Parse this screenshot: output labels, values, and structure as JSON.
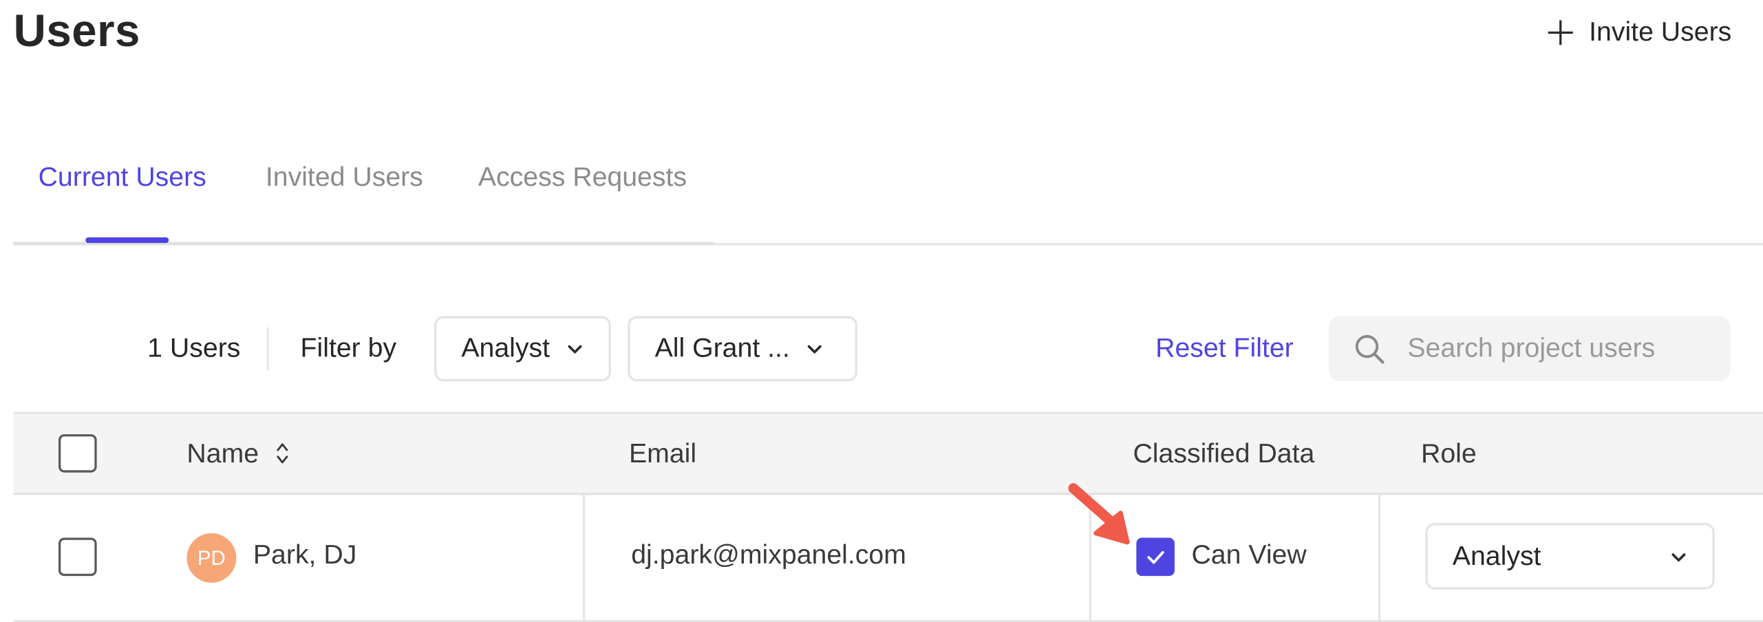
{
  "header": {
    "title": "Users",
    "invite_label": "Invite Users"
  },
  "tabs": [
    {
      "label": "Current Users",
      "active": true
    },
    {
      "label": "Invited Users",
      "active": false
    },
    {
      "label": "Access Requests",
      "active": false
    }
  ],
  "filters": {
    "user_count": "1 Users",
    "filter_by_label": "Filter by",
    "role_filter": "Analyst",
    "grant_filter": "All Grant ...",
    "reset_label": "Reset Filter",
    "search_placeholder": "Search project users"
  },
  "table": {
    "columns": [
      "Name",
      "Email",
      "Classified Data",
      "Role"
    ],
    "rows": [
      {
        "initials": "PD",
        "name": "Park, DJ",
        "email": "dj.park@mixpanel.com",
        "classified_data": "Can View",
        "classified_checked": true,
        "role": "Analyst"
      }
    ]
  },
  "colors": {
    "accent": "#4f44e0",
    "avatar": "#f7a678",
    "annotation_arrow": "#f05a4a"
  },
  "icons": [
    "plus-icon",
    "chevron-down-icon",
    "search-icon",
    "sort-icon",
    "check-icon",
    "annotation-arrow"
  ]
}
